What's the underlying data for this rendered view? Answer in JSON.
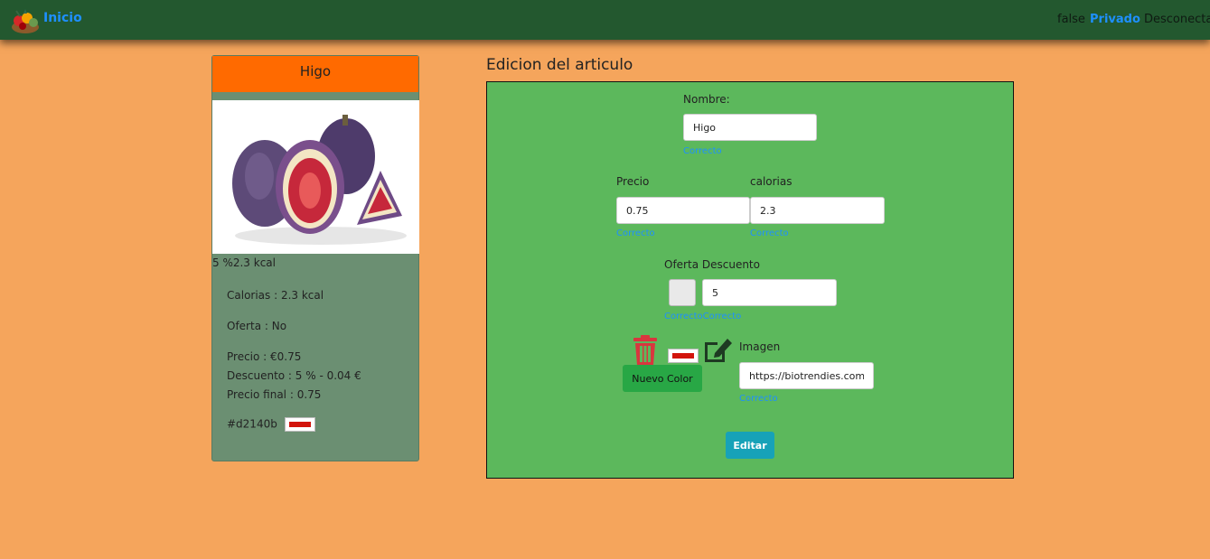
{
  "nav": {
    "brand": "Inicio",
    "status": "false",
    "privado": "Privado",
    "desconectar": "Desconectar"
  },
  "card": {
    "title": "Higo",
    "image_alt": "Higo",
    "summary": "5 %2.3 kcal",
    "calorias": "Calorias : 2.3 kcal",
    "oferta": "Oferta : No",
    "precio": "Precio : €0.75",
    "descuento": "Descuento : 5 % - 0.04 €",
    "precio_final": "Precio final : 0.75",
    "color_hex": "#d2140b"
  },
  "editor": {
    "title": "Edicion del articulo",
    "nombre_label": "Nombre:",
    "nombre_value": "Higo",
    "nombre_status": "Correcto",
    "precio_label": "Precio",
    "precio_value": "0.75",
    "precio_status": "Correcto",
    "calorias_label": "calorias",
    "calorias_value": "2.3",
    "calorias_status": "Correcto",
    "oferta_label": "Oferta Descuento",
    "oferta_checked": false,
    "descuento_value": "5",
    "oferta_status": "CorrectoCorrecto",
    "imagen_label": "Imagen",
    "imagen_value": "https://biotrendies.com",
    "imagen_status": "Correcto",
    "nuevo_color_label": "Nuevo Color",
    "editar_label": "Editar"
  },
  "colors": {
    "nav_bg": "#23582f",
    "page_bg": "#f5a55c",
    "card_head": "#ff6a00",
    "card_bg": "#6b8f72",
    "editor_bg": "#5cb85c",
    "selected_color": "#d2140b",
    "link": "#1e90ff"
  },
  "icons": {
    "logo": "fruit-basket-icon",
    "delete": "trash-icon",
    "edit": "edit-icon"
  }
}
